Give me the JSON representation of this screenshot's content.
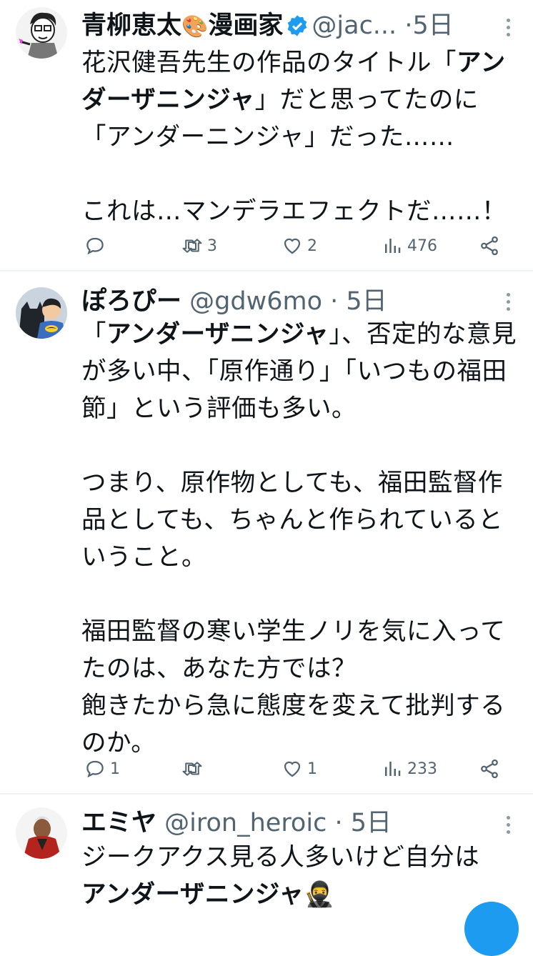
{
  "tweets": [
    {
      "name": "青柳恵太",
      "name_emoji": "🎨",
      "name_suffix": "漫画家",
      "handle": "@jac...",
      "dot": "·",
      "time": "5日",
      "text_parts": [
        {
          "t": "花沢健吾先生の作品のタイトル「",
          "b": false
        },
        {
          "t": "アンダーザニンジャ",
          "b": true
        },
        {
          "t": "」だと思ってたのに「アンダーニンジャ」だった……\n\nこれは…マンデラエフェクトだ……！",
          "b": false
        }
      ],
      "replies": "",
      "retweets": "3",
      "likes": "2",
      "views": "476"
    },
    {
      "name": "ぽろぴー",
      "handle": "@gdw6mo",
      "dot": "·",
      "time": "5日",
      "text_parts": [
        {
          "t": "「",
          "b": false
        },
        {
          "t": "アンダーザニンジャ",
          "b": true
        },
        {
          "t": "」、否定的な意見が多い中、「原作通り」「いつもの福田節」という評価も多い。\n\nつまり、原作物としても、福田監督作品としても、ちゃんと作られているということ。\n\n福田監督の寒い学生ノリを気に入ってたのは、あなた方では？\n飽きたから急に態度を変えて批判するのか。",
          "b": false
        }
      ],
      "replies": "1",
      "retweets": "",
      "likes": "1",
      "views": "233"
    },
    {
      "name": "エミヤ",
      "handle": "@iron_heroic",
      "dot": "·",
      "time": "5日",
      "text_parts": [
        {
          "t": "ジークアクス見る人多いけど自分は\n",
          "b": false
        },
        {
          "t": "アンダーザニンジャ",
          "b": true
        },
        {
          "t": "🥷",
          "b": false
        }
      ]
    }
  ]
}
